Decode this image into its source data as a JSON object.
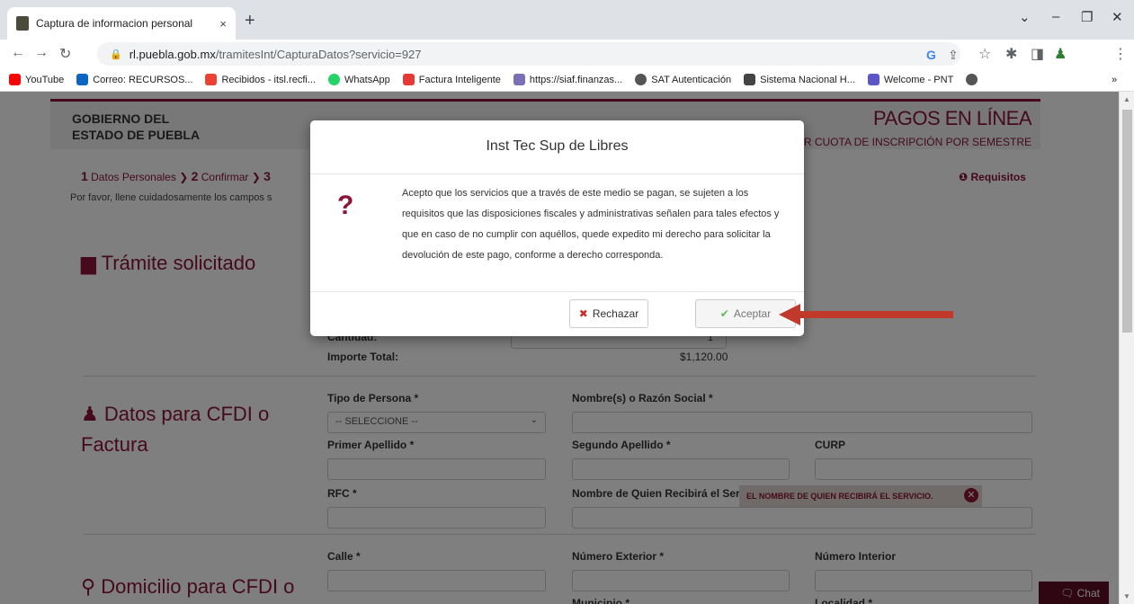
{
  "browser": {
    "tab_title": "Captura de informacion personal",
    "tab_close": "×",
    "new_tab": "+",
    "url_host": "rl.puebla.gob.mx",
    "url_path": "/tramitesInt/CapturaDatos?servicio=927",
    "bookmarks": [
      {
        "label": "YouTube",
        "color": "#ff0000"
      },
      {
        "label": "Correo: RECURSOS...",
        "color": "#0a66c2"
      },
      {
        "label": "Recibidos - itsl.recfi...",
        "color": "#ea4335"
      },
      {
        "label": "WhatsApp",
        "color": "#25d366"
      },
      {
        "label": "Factura Inteligente",
        "color": "#e53935"
      },
      {
        "label": "https://siaf.finanzas...",
        "color": "#7b6fb5"
      },
      {
        "label": "SAT Autenticación",
        "color": "#555555"
      },
      {
        "label": "Sistema Nacional H...",
        "color": "#444444"
      },
      {
        "label": "Welcome - PNT",
        "color": "#5b57c9"
      }
    ],
    "more_bookmarks": "»"
  },
  "page": {
    "gov_line1": "GOBIERNO DEL",
    "gov_line2": "ESTADO DE PUEBLA",
    "pagos_title": "PAGOS EN LÍNEA",
    "pagos_sub": "R CUOTA DE INSCRIPCIÓN POR SEMESTRE",
    "step1_num": "1",
    "step1_label": "Datos Personales",
    "step2_num": "2",
    "step2_label": "Confirmar",
    "step3_num": "3",
    "requisitos": "Requisitos",
    "instructions": "Por favor, llene cuidadosamente los campos s",
    "tramite_title": "Trámite solicitado",
    "cantidad_label": "Cantidad:",
    "cantidad_value": "1",
    "importe_label": "Importe Total:",
    "importe_value": "$1,120.00",
    "cfdi_title_1": "Datos para CFDI o",
    "cfdi_title_2": "Factura",
    "tipo_persona_label": "Tipo de Persona *",
    "tipo_persona_value": "-- SELECCIONE --",
    "nombre_label": "Nombre(s) o Razón Social *",
    "primer_apellido_label": "Primer Apellido *",
    "segundo_apellido_label": "Segundo Apellido *",
    "curp_label": "CURP",
    "rfc_label": "RFC *",
    "recibira_label": "Nombre de Quien Recibirá el Servicio",
    "error_text": "EL NOMBRE DE QUIEN RECIBIRÁ EL SERVICIO.",
    "domicilio_title": "Domicilio para CFDI o",
    "calle_label": "Calle *",
    "num_ext_label": "Número Exterior *",
    "num_int_label": "Número Interior",
    "municipio_label": "Municipio *",
    "localidad_label": "Localidad *",
    "chat_label": "Chat"
  },
  "modal": {
    "title": "Inst Tec Sup de Libres",
    "icon": "?",
    "body": "Acepto que los servicios que a través de este medio se pagan, se sujeten a los requisitos que las disposiciones fiscales y administrativas señalen para tales efectos y que en caso de no cumplir con aquéllos, quede expedito mi derecho para solicitar la devolución de este pago, conforme a derecho corresponda.",
    "reject_label": "Rechazar",
    "accept_label": "Aceptar"
  },
  "colors": {
    "brand": "#8a1538",
    "annotation_arrow": "#c0392b"
  }
}
